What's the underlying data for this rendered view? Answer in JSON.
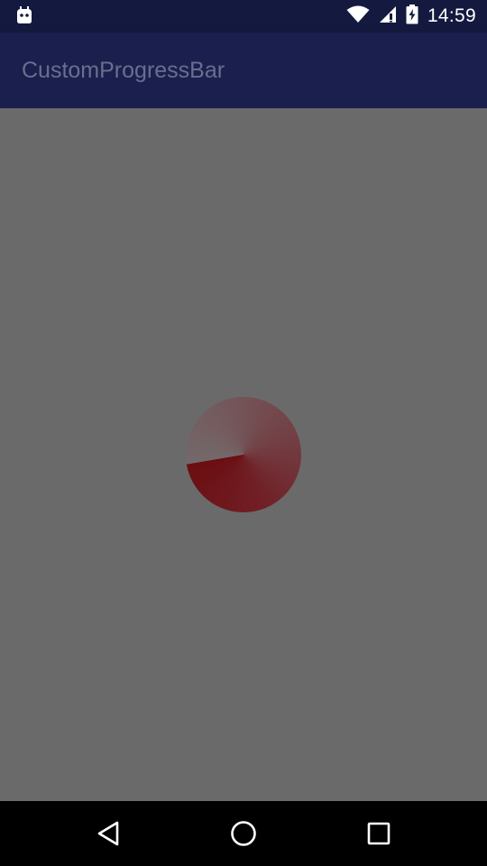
{
  "status_bar": {
    "time": "14:59",
    "icons": [
      "android-debug-icon",
      "wifi-icon",
      "signal-icon",
      "battery-icon"
    ]
  },
  "app_bar": {
    "title": "CustomProgressBar"
  },
  "progress": {
    "type": "circular-sweep",
    "fill_fraction": 0.99,
    "colors": {
      "start": "#73686a",
      "end": "#6b0e12"
    }
  },
  "navigation_bar": {
    "buttons": [
      "back-icon",
      "home-icon",
      "recents-icon"
    ]
  },
  "colors": {
    "status_bar": "#14193f",
    "app_bar": "#1a1f4e",
    "content_background": "#6a6a6a"
  }
}
